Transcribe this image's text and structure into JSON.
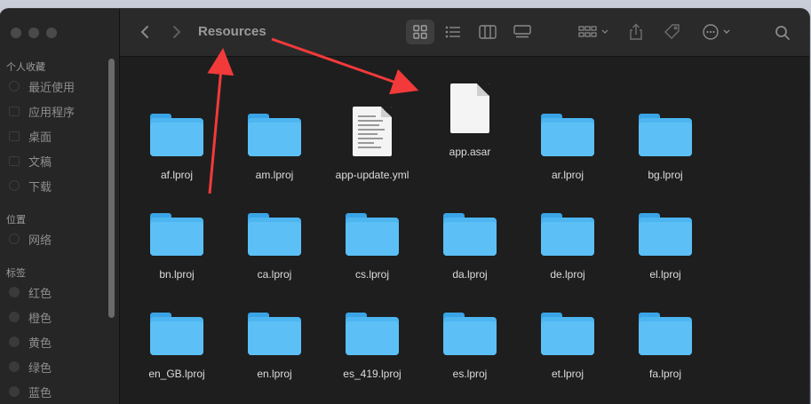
{
  "window": {
    "title": "Resources"
  },
  "sidebar": {
    "sections": [
      {
        "label": "个人收藏",
        "items": [
          "最近使用",
          "应用程序",
          "桌面",
          "文稿",
          "下载"
        ]
      },
      {
        "label": "位置",
        "items": [
          "网络"
        ]
      },
      {
        "label": "标签",
        "items": [
          "红色",
          "橙色",
          "黄色",
          "绿色",
          "蓝色"
        ]
      }
    ]
  },
  "toolbar": {
    "back_icon": "chevron-left-icon",
    "forward_icon": "chevron-right-icon",
    "view_modes": [
      "icon-view-icon",
      "list-view-icon",
      "column-view-icon",
      "gallery-view-icon"
    ],
    "selected_view": "icon-view-icon"
  },
  "files": [
    {
      "name": "af.lproj",
      "type": "folder"
    },
    {
      "name": "am.lproj",
      "type": "folder"
    },
    {
      "name": "app-update.yml",
      "type": "document"
    },
    {
      "name": "app.asar",
      "type": "blank-file"
    },
    {
      "name": "ar.lproj",
      "type": "folder"
    },
    {
      "name": "bg.lproj",
      "type": "folder"
    },
    {
      "name": "bn.lproj",
      "type": "folder"
    },
    {
      "name": "ca.lproj",
      "type": "folder"
    },
    {
      "name": "cs.lproj",
      "type": "folder"
    },
    {
      "name": "da.lproj",
      "type": "folder"
    },
    {
      "name": "de.lproj",
      "type": "folder"
    },
    {
      "name": "el.lproj",
      "type": "folder"
    },
    {
      "name": "en_GB.lproj",
      "type": "folder"
    },
    {
      "name": "en.lproj",
      "type": "folder"
    },
    {
      "name": "es_419.lproj",
      "type": "folder"
    },
    {
      "name": "es.lproj",
      "type": "folder"
    },
    {
      "name": "et.lproj",
      "type": "folder"
    },
    {
      "name": "fa.lproj",
      "type": "folder"
    }
  ],
  "colors": {
    "folder": "#4db6f1",
    "annotation_arrow": "#f23a3a",
    "window_bg": "#1e1e1e"
  }
}
